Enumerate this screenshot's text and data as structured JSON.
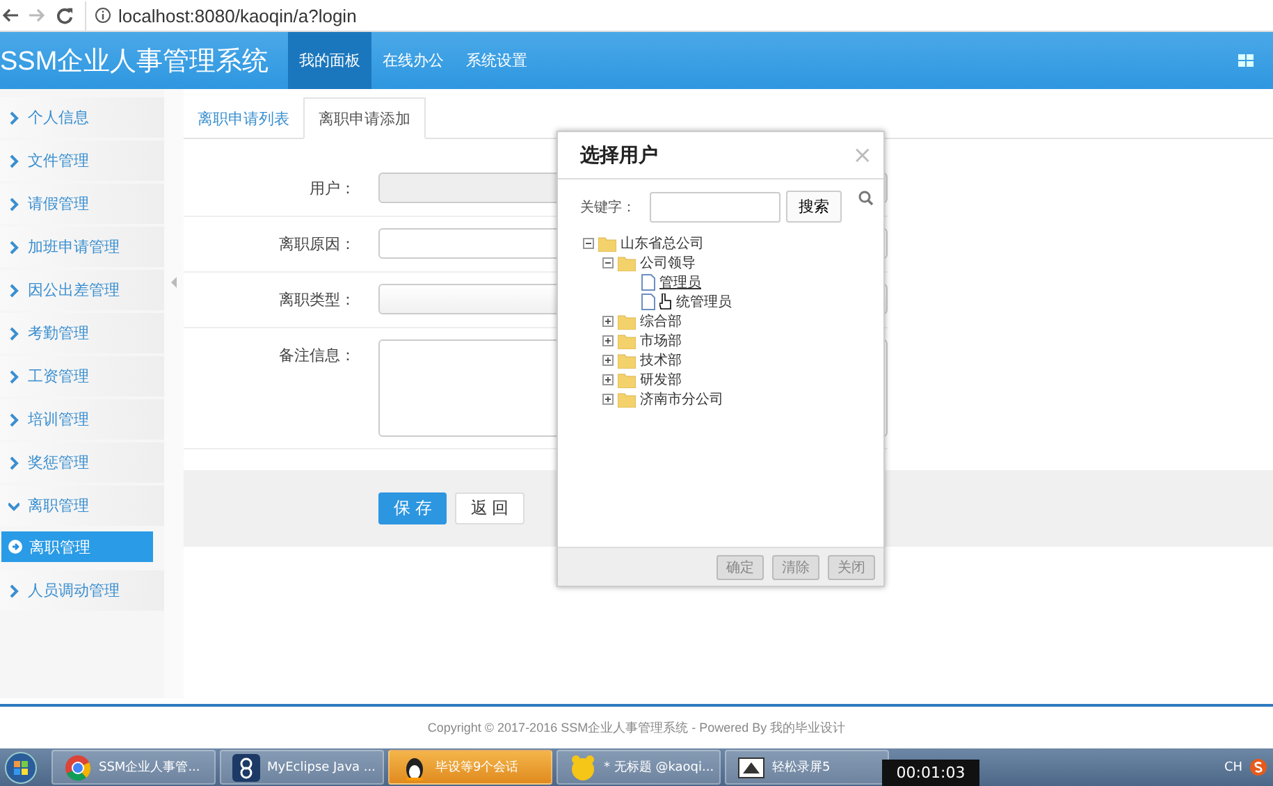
{
  "browser": {
    "url": "localhost:8080/kaoqin/a?login"
  },
  "header": {
    "title": "SSM企业人事管理系统",
    "nav": [
      {
        "label": "我的面板",
        "selected": true
      },
      {
        "label": "在线办公",
        "selected": false
      },
      {
        "label": "系统设置",
        "selected": false
      }
    ]
  },
  "sidebar": {
    "items": [
      {
        "label": "个人信息",
        "expanded": false
      },
      {
        "label": "文件管理",
        "expanded": false
      },
      {
        "label": "请假管理",
        "expanded": false
      },
      {
        "label": "加班申请管理",
        "expanded": false
      },
      {
        "label": "因公出差管理",
        "expanded": false
      },
      {
        "label": "考勤管理",
        "expanded": false
      },
      {
        "label": "工资管理",
        "expanded": false
      },
      {
        "label": "培训管理",
        "expanded": false
      },
      {
        "label": "奖惩管理",
        "expanded": false
      },
      {
        "label": "离职管理",
        "expanded": true,
        "children": [
          {
            "label": "离职管理",
            "selected": true
          }
        ]
      },
      {
        "label": "人员调动管理",
        "expanded": false
      }
    ]
  },
  "tabs": [
    {
      "label": "离职申请列表",
      "selected": false
    },
    {
      "label": "离职申请添加",
      "selected": true
    }
  ],
  "form": {
    "fields": [
      {
        "label": "用户：",
        "kind": "input",
        "disabled": true
      },
      {
        "label": "离职原因：",
        "kind": "input",
        "disabled": false
      },
      {
        "label": "离职类型：",
        "kind": "select",
        "disabled": false
      },
      {
        "label": "备注信息：",
        "kind": "textarea",
        "disabled": false
      }
    ],
    "buttons": [
      {
        "label": "保 存",
        "primary": true
      },
      {
        "label": "返 回",
        "primary": false
      }
    ]
  },
  "dialog": {
    "title": "选择用户",
    "close": "×",
    "keyword_label": "关键字：",
    "search_button": "搜索",
    "tree": [
      {
        "label": "山东省总公司",
        "kind": "folder",
        "expanded": true,
        "children": [
          {
            "label": "公司领导",
            "kind": "folder",
            "expanded": true,
            "children": [
              {
                "label": "管理员",
                "kind": "file",
                "hovered": true
              },
              {
                "label": "统管理员",
                "kind": "file",
                "hovered": false
              }
            ]
          },
          {
            "label": "综合部",
            "kind": "folder",
            "expanded": false
          },
          {
            "label": "市场部",
            "kind": "folder",
            "expanded": false
          },
          {
            "label": "技术部",
            "kind": "folder",
            "expanded": false
          },
          {
            "label": "研发部",
            "kind": "folder",
            "expanded": false
          },
          {
            "label": "济南市分公司",
            "kind": "folder",
            "expanded": false
          }
        ]
      }
    ],
    "buttons": [
      "确定",
      "清除",
      "关闭"
    ]
  },
  "footer": {
    "text": "Copyright © 2017-2016 SSM企业人事管理系统 - Powered By 我的毕业设计"
  },
  "taskbar": {
    "items": [
      {
        "label": "SSM企业人事管...",
        "selected": false
      },
      {
        "label": "MyEclipse Java ...",
        "selected": false
      },
      {
        "label": "毕设等9个会话",
        "selected": true
      },
      {
        "label": "* 无标题 @kaoqi...",
        "selected": false
      },
      {
        "label": "轻松录屏5",
        "selected": false
      }
    ],
    "timer": "00:01:03",
    "tray": "CH"
  }
}
